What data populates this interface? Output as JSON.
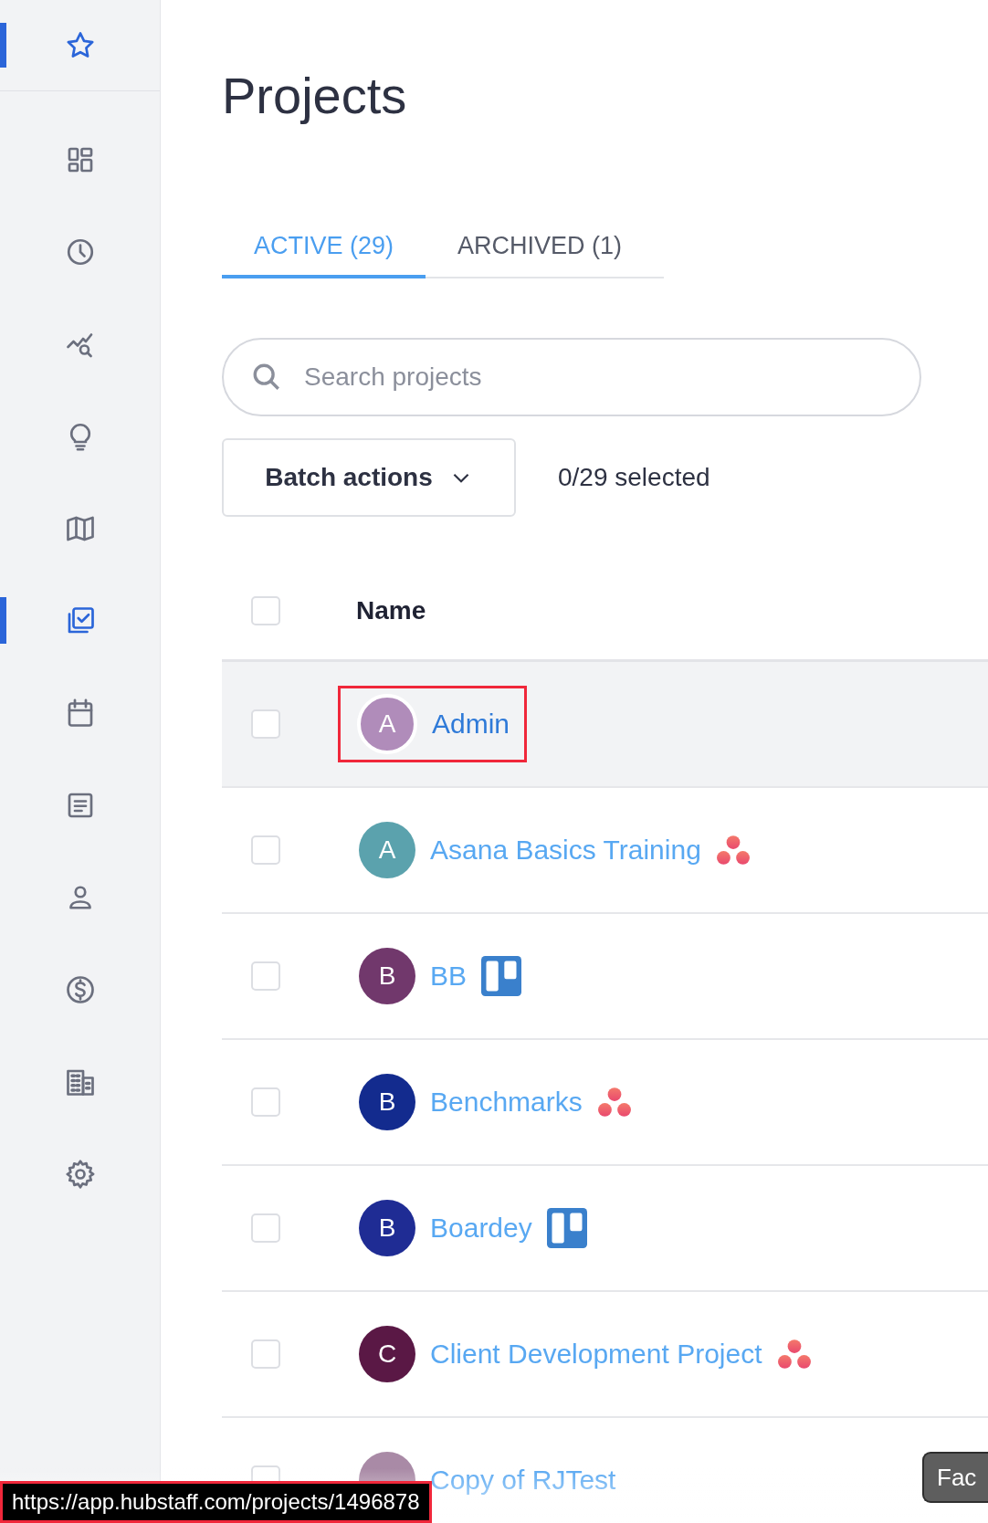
{
  "sidebar": {
    "items": [
      {
        "kind": "star",
        "selected": true
      },
      {
        "kind": "dashboard",
        "selected": false
      },
      {
        "kind": "clock",
        "selected": false
      },
      {
        "kind": "insights",
        "selected": false
      },
      {
        "kind": "bulb",
        "selected": false
      },
      {
        "kind": "map",
        "selected": false
      },
      {
        "kind": "projects",
        "selected": true
      },
      {
        "kind": "calendar",
        "selected": false
      },
      {
        "kind": "report",
        "selected": false
      },
      {
        "kind": "person",
        "selected": false
      },
      {
        "kind": "dollar",
        "selected": false
      },
      {
        "kind": "building",
        "selected": false
      },
      {
        "kind": "gear",
        "selected": false
      }
    ]
  },
  "page_title": "Projects",
  "tabs": [
    {
      "label": "ACTIVE (29)",
      "selected": true
    },
    {
      "label": "ARCHIVED (1)",
      "selected": false
    }
  ],
  "search": {
    "placeholder": "Search projects"
  },
  "batch_actions": {
    "label": "Batch actions"
  },
  "selection_count": "0/29 selected",
  "table": {
    "header_checked": false,
    "columns": [
      "Name"
    ],
    "rows": [
      {
        "letter": "A",
        "name": "Admin",
        "color": "#b08cba",
        "kind": "none",
        "checked": false,
        "hovered": true,
        "marked": true
      },
      {
        "letter": "A",
        "name": "Asana Basics Training",
        "color": "#5ba2ad",
        "kind": "asana",
        "checked": false,
        "hovered": false,
        "marked": false
      },
      {
        "letter": "B",
        "name": "BB",
        "color": "#71386c",
        "kind": "trello",
        "checked": false,
        "hovered": false,
        "marked": false
      },
      {
        "letter": "B",
        "name": "Benchmarks",
        "color": "#132b8e",
        "kind": "asana",
        "checked": false,
        "hovered": false,
        "marked": false
      },
      {
        "letter": "B",
        "name": "Boardey",
        "color": "#1f2c94",
        "kind": "trello",
        "checked": false,
        "hovered": false,
        "marked": false
      },
      {
        "letter": "C",
        "name": "Client Development Project",
        "color": "#5a1845",
        "kind": "asana",
        "checked": false,
        "hovered": false,
        "marked": false
      },
      {
        "name": "Copy of RJTest",
        "color": "#a98aa6",
        "kind": "none",
        "hovered": false,
        "marked": false
      }
    ]
  },
  "floating_button": {
    "label": "Fac"
  },
  "status_url": "https://app.hubstaff.com/projects/1496878"
}
